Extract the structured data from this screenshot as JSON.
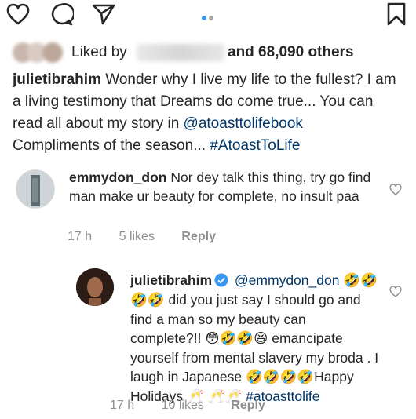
{
  "post": {
    "liked_by_label": "Liked by",
    "likes_count": "and 68,090 others",
    "caption_user": "julietibrahim",
    "caption_text": "Wonder why I live my life to the fullest? I am a living testimony that Dreams do come true... You can read all about my story in",
    "caption_mention": "@atoasttolifebook",
    "caption_text2": "Compliments of the season...",
    "caption_hashtag": "#AtoastToLife"
  },
  "comments": [
    {
      "user": "emmydon_don",
      "text": "Nor dey talk this thing, try go find man make ur beauty for complete, no insult paa",
      "time": "17 h",
      "likes": "5 likes",
      "reply": "Reply"
    },
    {
      "user": "julietibrahim",
      "mention": "@emmydon_don",
      "emoji_a": "🤣🤣",
      "emoji_b": "🤣🤣",
      "text1": "did you just say I should go and find a man so my beauty can complete?!!",
      "emoji_c": "😳🤣🤣😆",
      "text2": "emancipate yourself from mental slavery my broda . I laugh in Japanese",
      "emoji_d": "🤣🤣🤣🤣",
      "text3": "Happy Holidays",
      "emoji_e": "🥂",
      "emoji_f": "🥂🥂",
      "hashtag": "#atoasttolife",
      "time": "17 h",
      "likes": "10 likes",
      "reply": "Reply"
    }
  ],
  "colors": {
    "link": "#00376b",
    "meta": "#8e8e8e",
    "carousel_active": "#3897f0",
    "verified": "#3897f0"
  },
  "icons": [
    "heart-icon",
    "comment-icon",
    "share-icon",
    "bookmark-icon",
    "verified-icon"
  ]
}
